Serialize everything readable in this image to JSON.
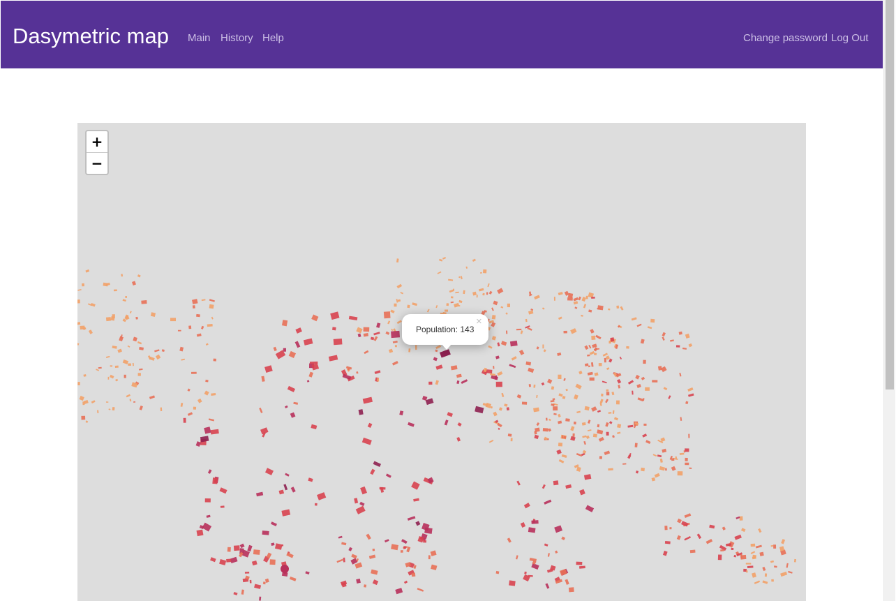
{
  "app": {
    "brand": "Dasymetric map",
    "nav_left": [
      "Main",
      "History",
      "Help"
    ],
    "nav_right": [
      "Change password",
      "Log Out"
    ]
  },
  "map": {
    "zoom_in_label": "+",
    "zoom_out_label": "−",
    "popup": {
      "text": "Population: 143",
      "close_label": "×"
    },
    "colors": {
      "background": "#dddddd",
      "low": "#f2a168",
      "mid_low": "#e87057",
      "mid": "#d8434f",
      "mid_high": "#b8305b",
      "high": "#8e2050",
      "nav": "#563296"
    }
  }
}
